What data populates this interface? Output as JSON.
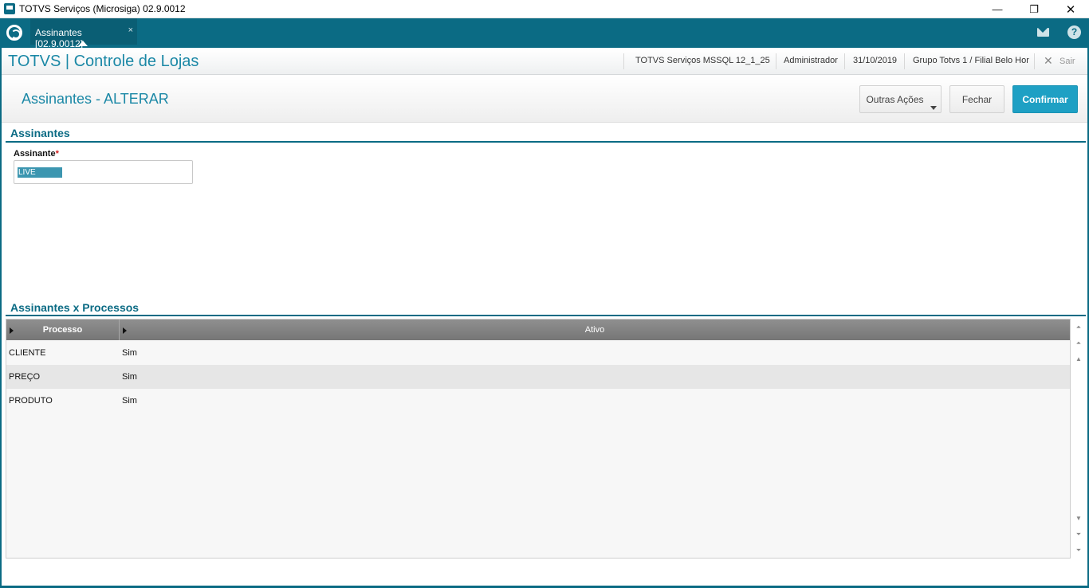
{
  "window": {
    "title": "TOTVS Serviços (Microsiga) 02.9.0012",
    "minimize": "—",
    "maximize": "❐",
    "close": "✕"
  },
  "tabbar": {
    "tab_label": "Assinantes [02.9.0012]",
    "tab_close": "×",
    "help": "?"
  },
  "header": {
    "brand": "TOTVS | Controle de Lojas",
    "environment": "TOTVS Serviços MSSQL 12_1_25",
    "user": "Administrador",
    "date": "31/10/2019",
    "branch": "Grupo Totvs 1 / Filial Belo Hor",
    "exit_icon": "✕",
    "exit_label": "Sair"
  },
  "page": {
    "title": "Assinantes - ALTERAR",
    "buttons": {
      "outras_acoes": "Outras Ações",
      "fechar": "Fechar",
      "confirmar": "Confirmar"
    }
  },
  "form": {
    "section_title": "Assinantes",
    "field_label": "Assinante",
    "required_mark": "*",
    "field_value": "LIVE"
  },
  "grid": {
    "section_title": "Assinantes x Processos",
    "columns": [
      "Processo",
      "Ativo"
    ],
    "rows": [
      [
        "CLIENTE",
        "Sim"
      ],
      [
        "PREÇO",
        "Sim"
      ],
      [
        "PRODUTO",
        "Sim"
      ]
    ]
  },
  "scroll": {
    "top": "⏶",
    "page_up": "⏶",
    "up": "▲",
    "down": "▼",
    "page_down": "⏷",
    "bottom": "⏷"
  },
  "colors": {
    "brand_teal": "#0b6b84",
    "accent_blue": "#1ea0c4"
  }
}
